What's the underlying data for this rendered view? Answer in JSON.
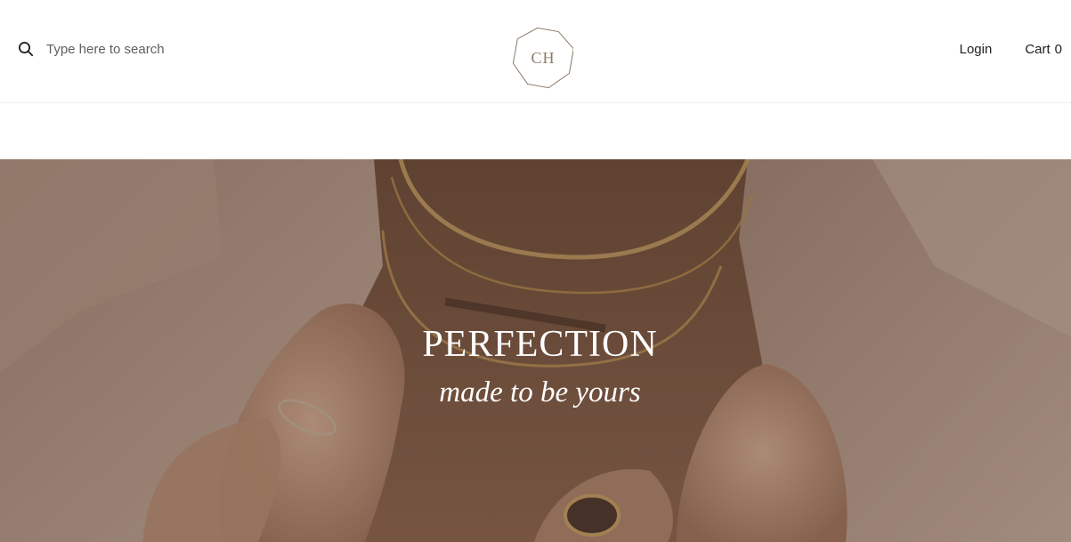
{
  "header": {
    "search": {
      "placeholder": "Type here to search",
      "icon": "search-icon"
    },
    "logo": {
      "text": "CH"
    },
    "nav": {
      "login_label": "Login",
      "cart_label": "Cart",
      "cart_count": "0"
    }
  },
  "hero": {
    "title": "PERFECTION",
    "subtitle": "made to be yours"
  },
  "colors": {
    "logo": "#8c7a66",
    "hero_overlay": "#6e5444",
    "text_dark": "#1e1e1e"
  }
}
